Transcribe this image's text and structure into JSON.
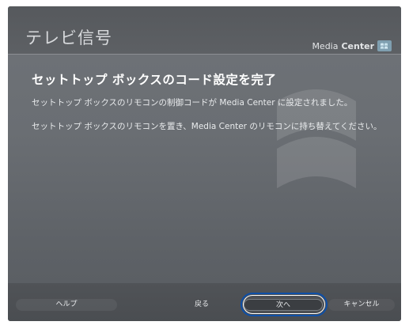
{
  "header": {
    "title": "テレビ信号",
    "brand": {
      "prefix": "Media",
      "bold": "Center",
      "logo_icon": "windows-media-center-logo"
    }
  },
  "content": {
    "heading": "セットトップ ボックスのコード設定を完了",
    "line1": "セットトップ ボックスのリモコンの制御コードが Media Center に設定されました。",
    "line2": "セットトップ ボックスのリモコンを置き、Media Center のリモコンに持ち替えてください。"
  },
  "buttons": {
    "help": "ヘルプ",
    "back": "戻る",
    "next": "次へ",
    "cancel": "キャンセル"
  },
  "focused_button": "next",
  "colors": {
    "background": "#6b6f74",
    "focus_ring": "#0d4fa8",
    "heading_text": "#ffffff"
  }
}
